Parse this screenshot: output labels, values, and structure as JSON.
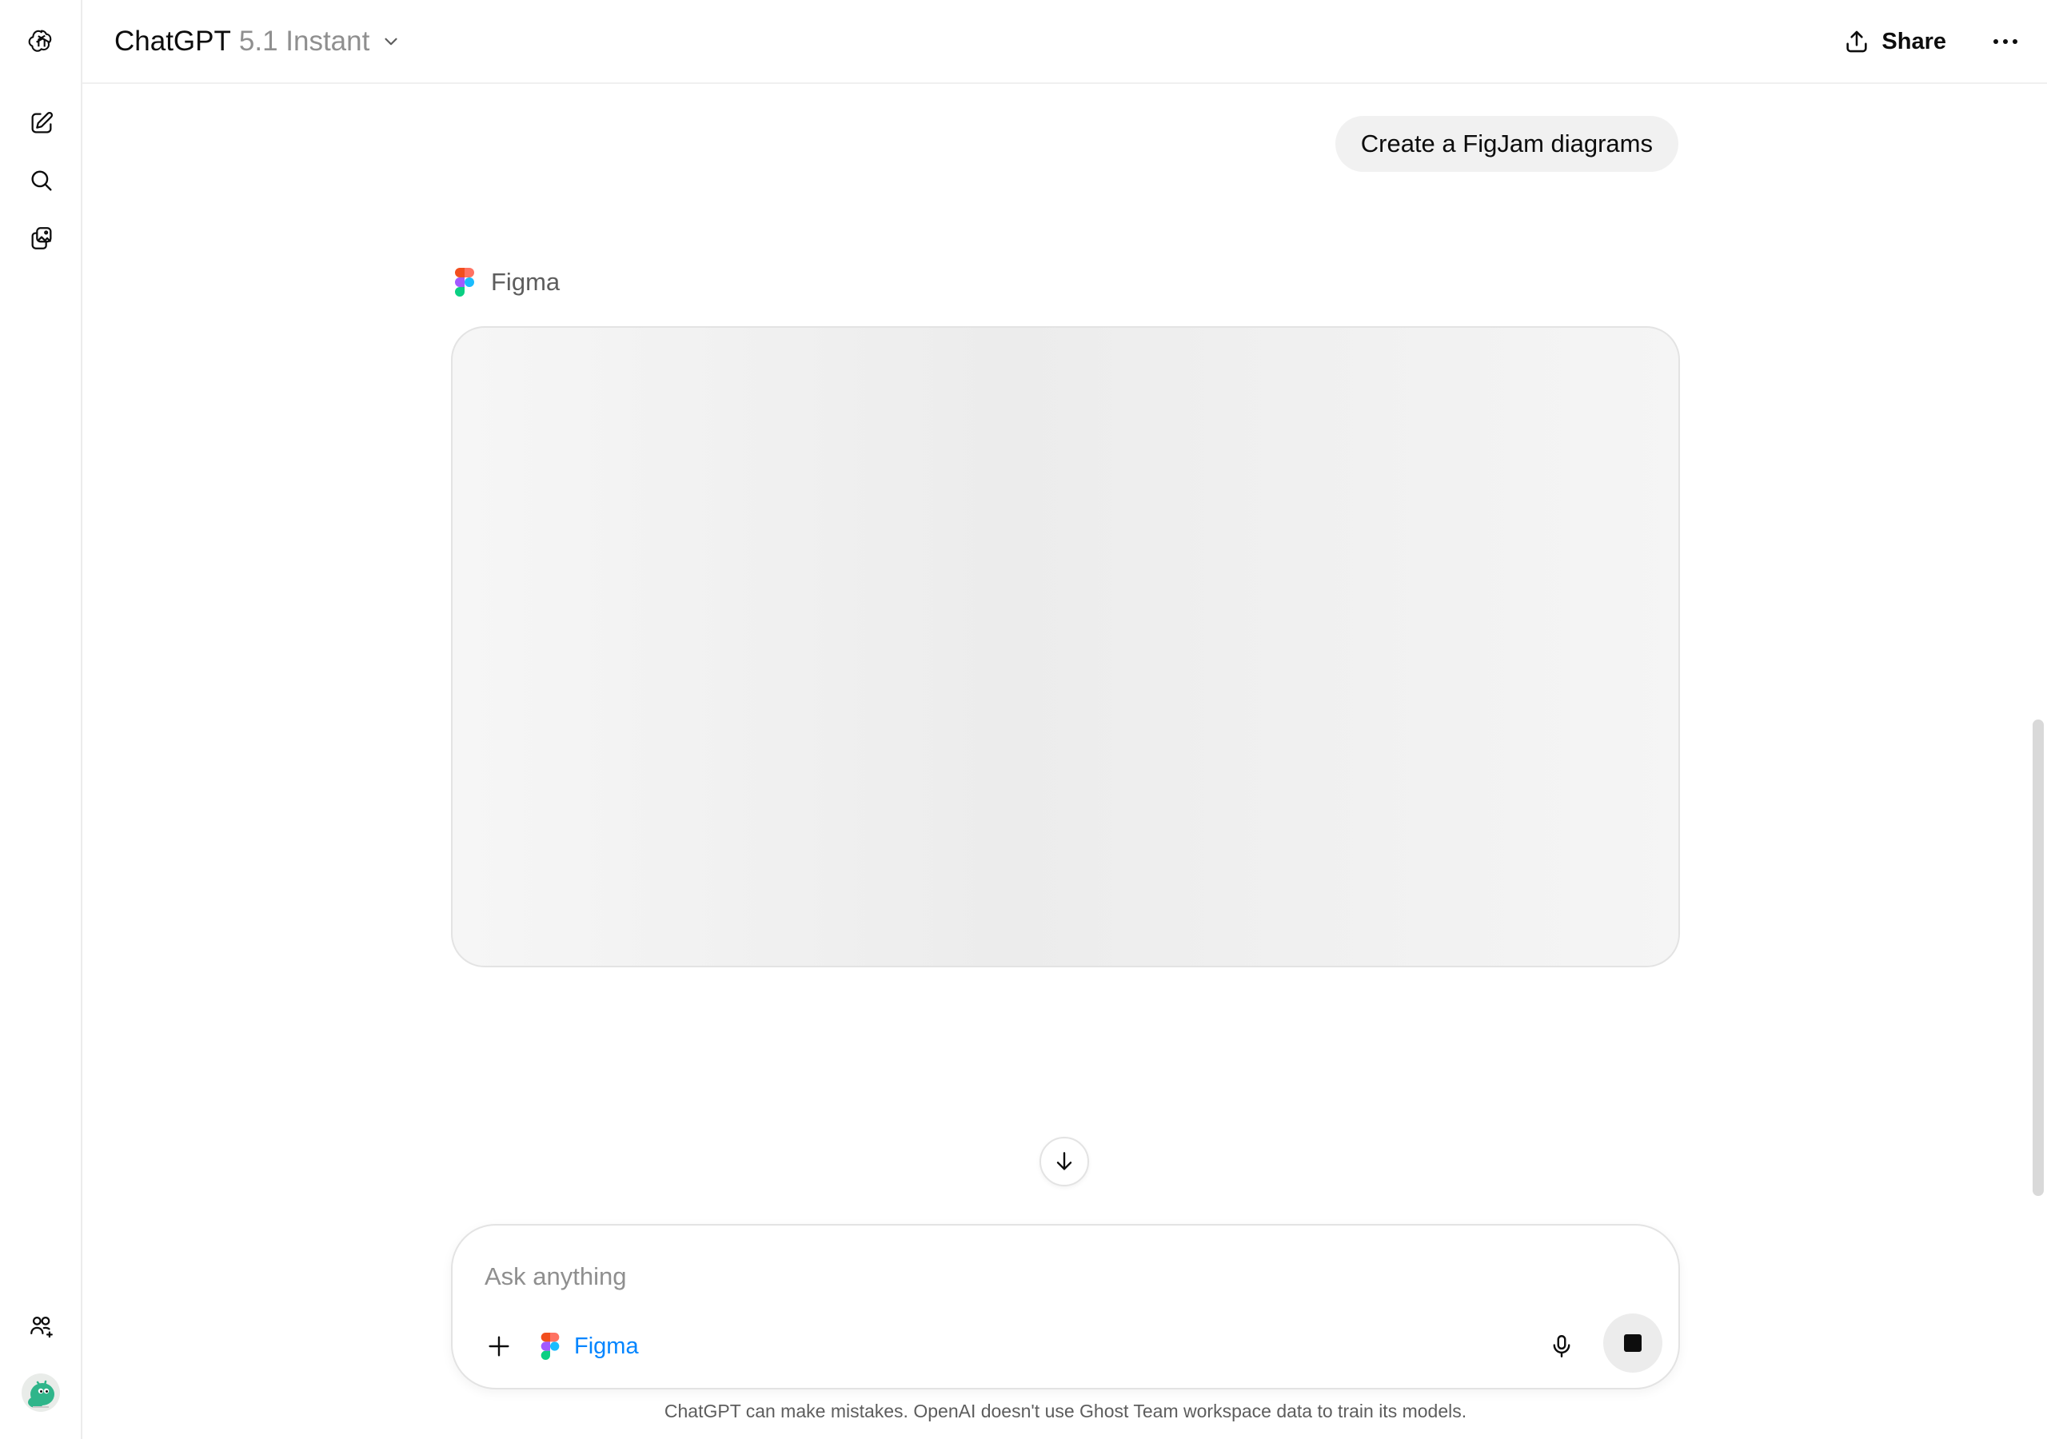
{
  "rail": {
    "icons": [
      "openai-logo-icon",
      "new-chat-icon",
      "search-icon",
      "library-icon",
      "invite-members-icon"
    ]
  },
  "header": {
    "model_name": "ChatGPT",
    "model_version": "5.1 Instant",
    "share_label": "Share"
  },
  "conversation": {
    "user_message": "Create a FigJam diagrams",
    "tool_name": "Figma"
  },
  "composer": {
    "placeholder": "Ask anything",
    "active_tool_label": "Figma"
  },
  "footer": {
    "disclaimer": "ChatGPT can make mistakes. OpenAI doesn't use Ghost Team workspace data to train its models."
  },
  "colors": {
    "accent_link": "#0285ff",
    "bubble_bg": "#f1f1f1",
    "figma_red": "#f24e1e",
    "figma_orange": "#ff7262",
    "figma_purple": "#a259ff",
    "figma_blue": "#1abcfe",
    "figma_green": "#0acf83"
  }
}
